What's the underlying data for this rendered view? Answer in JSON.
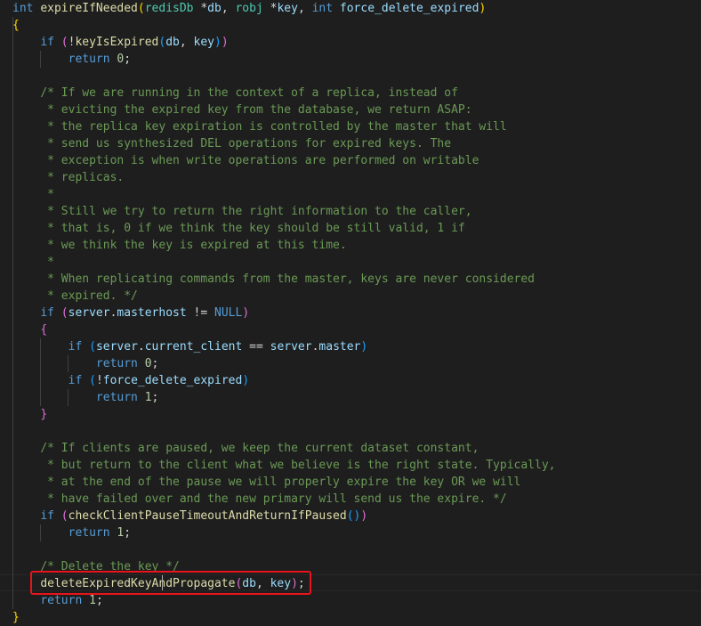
{
  "editor": {
    "language": "c",
    "theme_colors": {
      "background": "#1e1e1e",
      "keyword": "#569cd6",
      "function": "#dcdcaa",
      "variable": "#9cdcfe",
      "comment": "#6a9955",
      "number": "#b5cea8",
      "highlight_box": "#e8141c"
    },
    "lines": [
      [
        [
          "kw",
          "int"
        ],
        [
          "plain",
          " "
        ],
        [
          "fn",
          "expireIfNeeded"
        ],
        [
          "br1",
          "("
        ],
        [
          "ty",
          "redisDb"
        ],
        [
          "plain",
          " *"
        ],
        [
          "var",
          "db"
        ],
        [
          "plain",
          ", "
        ],
        [
          "ty",
          "robj"
        ],
        [
          "plain",
          " *"
        ],
        [
          "var",
          "key"
        ],
        [
          "plain",
          ", "
        ],
        [
          "kw",
          "int"
        ],
        [
          "plain",
          " "
        ],
        [
          "var",
          "force_delete_expired"
        ],
        [
          "br1",
          ")"
        ]
      ],
      [
        [
          "br1",
          "{"
        ]
      ],
      [
        [
          "plain",
          "    "
        ],
        [
          "kw",
          "if"
        ],
        [
          "plain",
          " "
        ],
        [
          "br2",
          "("
        ],
        [
          "plain",
          "!"
        ],
        [
          "fn",
          "keyIsExpired"
        ],
        [
          "br3",
          "("
        ],
        [
          "var",
          "db"
        ],
        [
          "plain",
          ", "
        ],
        [
          "var",
          "key"
        ],
        [
          "br3",
          ")"
        ],
        [
          "br2",
          ")"
        ]
      ],
      [
        [
          "plain",
          "        "
        ],
        [
          "kw",
          "return"
        ],
        [
          "plain",
          " "
        ],
        [
          "num",
          "0"
        ],
        [
          "plain",
          ";"
        ]
      ],
      [],
      [
        [
          "plain",
          "    "
        ],
        [
          "cm",
          "/* If we are running in the context of a replica, instead of"
        ]
      ],
      [
        [
          "plain",
          "     "
        ],
        [
          "cm",
          "* evicting the expired key from the database, we return ASAP:"
        ]
      ],
      [
        [
          "plain",
          "     "
        ],
        [
          "cm",
          "* the replica key expiration is controlled by the master that will"
        ]
      ],
      [
        [
          "plain",
          "     "
        ],
        [
          "cm",
          "* send us synthesized DEL operations for expired keys. The"
        ]
      ],
      [
        [
          "plain",
          "     "
        ],
        [
          "cm",
          "* exception is when write operations are performed on writable"
        ]
      ],
      [
        [
          "plain",
          "     "
        ],
        [
          "cm",
          "* replicas."
        ]
      ],
      [
        [
          "plain",
          "     "
        ],
        [
          "cm",
          "*"
        ]
      ],
      [
        [
          "plain",
          "     "
        ],
        [
          "cm",
          "* Still we try to return the right information to the caller,"
        ]
      ],
      [
        [
          "plain",
          "     "
        ],
        [
          "cm",
          "* that is, 0 if we think the key should be still valid, 1 if"
        ]
      ],
      [
        [
          "plain",
          "     "
        ],
        [
          "cm",
          "* we think the key is expired at this time."
        ]
      ],
      [
        [
          "plain",
          "     "
        ],
        [
          "cm",
          "*"
        ]
      ],
      [
        [
          "plain",
          "     "
        ],
        [
          "cm",
          "* When replicating commands from the master, keys are never considered"
        ]
      ],
      [
        [
          "plain",
          "     "
        ],
        [
          "cm",
          "* expired. */"
        ]
      ],
      [
        [
          "plain",
          "    "
        ],
        [
          "kw",
          "if"
        ],
        [
          "plain",
          " "
        ],
        [
          "br2",
          "("
        ],
        [
          "var",
          "server"
        ],
        [
          "plain",
          "."
        ],
        [
          "var",
          "masterhost"
        ],
        [
          "plain",
          " != "
        ],
        [
          "kw",
          "NULL"
        ],
        [
          "br2",
          ")"
        ]
      ],
      [
        [
          "plain",
          "    "
        ],
        [
          "br2",
          "{"
        ]
      ],
      [
        [
          "plain",
          "        "
        ],
        [
          "kw",
          "if"
        ],
        [
          "plain",
          " "
        ],
        [
          "br3",
          "("
        ],
        [
          "var",
          "server"
        ],
        [
          "plain",
          "."
        ],
        [
          "var",
          "current_client"
        ],
        [
          "plain",
          " == "
        ],
        [
          "var",
          "server"
        ],
        [
          "plain",
          "."
        ],
        [
          "var",
          "master"
        ],
        [
          "br3",
          ")"
        ]
      ],
      [
        [
          "plain",
          "            "
        ],
        [
          "kw",
          "return"
        ],
        [
          "plain",
          " "
        ],
        [
          "num",
          "0"
        ],
        [
          "plain",
          ";"
        ]
      ],
      [
        [
          "plain",
          "        "
        ],
        [
          "kw",
          "if"
        ],
        [
          "plain",
          " "
        ],
        [
          "br3",
          "("
        ],
        [
          "plain",
          "!"
        ],
        [
          "var",
          "force_delete_expired"
        ],
        [
          "br3",
          ")"
        ]
      ],
      [
        [
          "plain",
          "            "
        ],
        [
          "kw",
          "return"
        ],
        [
          "plain",
          " "
        ],
        [
          "num",
          "1"
        ],
        [
          "plain",
          ";"
        ]
      ],
      [
        [
          "plain",
          "    "
        ],
        [
          "br2",
          "}"
        ]
      ],
      [],
      [
        [
          "plain",
          "    "
        ],
        [
          "cm",
          "/* If clients are paused, we keep the current dataset constant,"
        ]
      ],
      [
        [
          "plain",
          "     "
        ],
        [
          "cm",
          "* but return to the client what we believe is the right state. Typically,"
        ]
      ],
      [
        [
          "plain",
          "     "
        ],
        [
          "cm",
          "* at the end of the pause we will properly expire the key OR we will"
        ]
      ],
      [
        [
          "plain",
          "     "
        ],
        [
          "cm",
          "* have failed over and the new primary will send us the expire. */"
        ]
      ],
      [
        [
          "plain",
          "    "
        ],
        [
          "kw",
          "if"
        ],
        [
          "plain",
          " "
        ],
        [
          "br2",
          "("
        ],
        [
          "fn",
          "checkClientPauseTimeoutAndReturnIfPaused"
        ],
        [
          "br3",
          "("
        ],
        [
          "br3",
          ")"
        ],
        [
          "br2",
          ")"
        ]
      ],
      [
        [
          "plain",
          "        "
        ],
        [
          "kw",
          "return"
        ],
        [
          "plain",
          " "
        ],
        [
          "num",
          "1"
        ],
        [
          "plain",
          ";"
        ]
      ],
      [],
      [
        [
          "plain",
          "    "
        ],
        [
          "cm",
          "/* Delete the key */"
        ]
      ],
      [
        [
          "plain",
          "    "
        ],
        [
          "fn",
          "deleteExpiredKeyAndPropagate"
        ],
        [
          "br2",
          "("
        ],
        [
          "var",
          "db"
        ],
        [
          "plain",
          ", "
        ],
        [
          "var",
          "key"
        ],
        [
          "br2",
          ")"
        ],
        [
          "plain",
          ";"
        ]
      ],
      [
        [
          "plain",
          "    "
        ],
        [
          "kw",
          "return"
        ],
        [
          "plain",
          " "
        ],
        [
          "num",
          "1"
        ],
        [
          "plain",
          ";"
        ]
      ],
      [
        [
          "br1",
          "}"
        ]
      ]
    ]
  }
}
